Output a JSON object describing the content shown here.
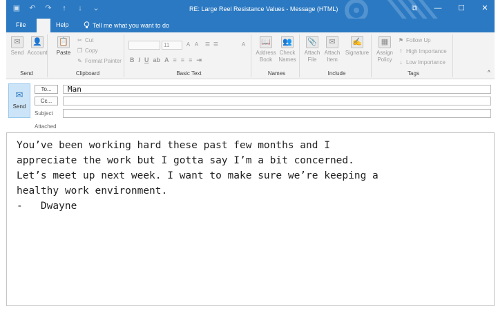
{
  "window": {
    "title": "RE: Large Reel Resistance Values - Message (HTML)"
  },
  "qat": {
    "items": [
      {
        "name": "save-icon",
        "glyph": "▣"
      },
      {
        "name": "undo-icon",
        "glyph": "↶"
      },
      {
        "name": "redo-icon",
        "glyph": "↷"
      },
      {
        "name": "up-arrow-icon",
        "glyph": "↑"
      },
      {
        "name": "down-arrow-icon",
        "glyph": "↓"
      },
      {
        "name": "customize-icon",
        "glyph": "⌄"
      }
    ]
  },
  "window_controls": {
    "restore_glyph": "⧉",
    "minimize_glyph": "—",
    "maximize_glyph": "☐",
    "close_glyph": "✕"
  },
  "menu": {
    "file": "File",
    "help": "Help",
    "tell_me": "Tell me what you want to do"
  },
  "ribbon": {
    "send_group": {
      "send": "Send",
      "account": "Account",
      "label": "Send"
    },
    "clipboard": {
      "paste": "Paste",
      "cut": "Cut",
      "copy": "Copy",
      "format_painter": "Format Painter",
      "label": "Clipboard"
    },
    "basic_text": {
      "font_size": "11",
      "bold": "B",
      "italic": "I",
      "underline": "U",
      "label": "Basic Text"
    },
    "names": {
      "address_book_1": "Address",
      "address_book_2": "Book",
      "check_names_1": "Check",
      "check_names_2": "Names",
      "label": "Names"
    },
    "include": {
      "attach_file_1": "Attach",
      "attach_file_2": "File",
      "attach_item_1": "Attach",
      "attach_item_2": "Item",
      "signature": "Signature",
      "label": "Include"
    },
    "tags": {
      "assign_policy_1": "Assign",
      "assign_policy_2": "Policy",
      "follow_up": "Follow Up",
      "high_importance": "High Importance",
      "low_importance": "Low Importance",
      "label": "Tags"
    }
  },
  "compose": {
    "send_label": "Send",
    "to_label": "To...",
    "cc_label": "Cc...",
    "subject_label": "Subject",
    "attached_label": "Attached",
    "to_value": "Man",
    "cc_value": "",
    "subject_value": ""
  },
  "body": {
    "lines": [
      "You’ve been working hard these past few months and I",
      "appreciate the work but I gotta say I’m a bit concerned.",
      "Let’s meet up next week. I want to make sure we’re keeping a",
      "healthy work environment.",
      "-   Dwayne"
    ]
  },
  "colors": {
    "accent": "#2b79c2",
    "ribbon_bg": "#f3f3f3",
    "send_button_bg": "#cce4f7"
  }
}
